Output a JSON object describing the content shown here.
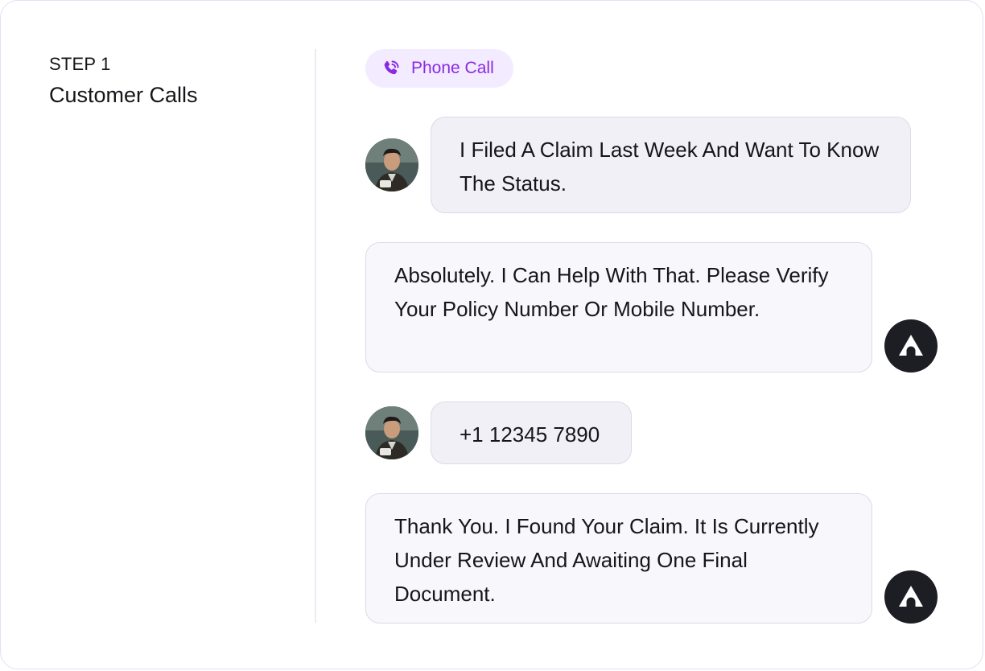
{
  "step": {
    "label": "STEP 1",
    "title": "Customer Calls"
  },
  "channel": {
    "icon": "phone-call-icon",
    "label": "Phone Call",
    "accent_color": "#8a2be2",
    "background_color": "#f3ebff"
  },
  "messages": [
    {
      "role": "customer",
      "avatar": "customer-photo-avatar",
      "text": "I Filed A Claim Last Week And Want To Know The Status."
    },
    {
      "role": "agent",
      "avatar": "assistant-logo-avatar",
      "text": "Absolutely. I Can Help With That. Please Verify Your Policy Number Or Mobile Number."
    },
    {
      "role": "customer",
      "avatar": "customer-photo-avatar",
      "text": "+1 12345 7890"
    },
    {
      "role": "agent",
      "avatar": "assistant-logo-avatar",
      "text": "Thank You. I Found Your Claim. It Is Currently Under Review And Awaiting One Final Document."
    }
  ],
  "colors": {
    "agent_avatar_bg": "#1d1d24",
    "user_bubble_bg": "#f1f0f6",
    "agent_bubble_bg": "#f8f7fc"
  }
}
